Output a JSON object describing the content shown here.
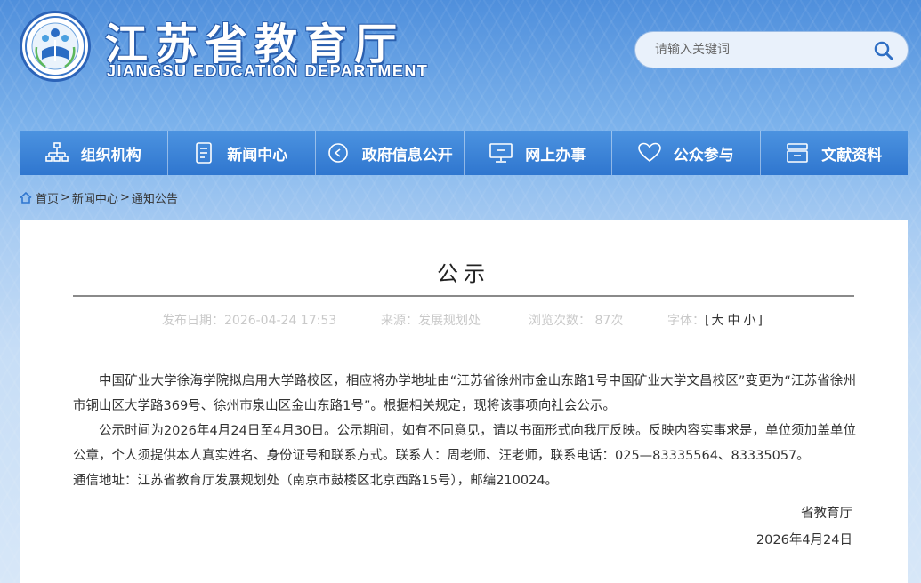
{
  "header": {
    "title": "江苏省教育厅",
    "subtitle": "JIANGSU EDUCATION DEPARTMENT",
    "search_placeholder": "请输入关键词"
  },
  "nav": {
    "items": [
      {
        "label": "组织机构",
        "icon": "org-chart-icon"
      },
      {
        "label": "新闻中心",
        "icon": "news-document-icon"
      },
      {
        "label": "政府信息公开",
        "icon": "info-disclosure-icon"
      },
      {
        "label": "网上办事",
        "icon": "monitor-icon"
      },
      {
        "label": "公众参与",
        "icon": "heart-icon"
      },
      {
        "label": "文献资料",
        "icon": "archive-icon"
      }
    ]
  },
  "breadcrumb": {
    "home": "首页",
    "sep": ">",
    "level1": "新闻中心",
    "level2": "通知公告"
  },
  "article": {
    "title": "公示",
    "publish": "发布日期：2026-04-24 17:53",
    "source": "来源：发展规划处",
    "views": "浏览次数： 87次",
    "font_label": "字体：",
    "font_large": "大",
    "font_medium": "中",
    "font_small": "小",
    "paragraph1": "中国矿业大学徐海学院拟启用大学路校区，相应将办学地址由“江苏省徐州市金山东路1号中国矿业大学文昌校区”变更为“江苏省徐州市铜山区大学路369号、徐州市泉山区金山东路1号”。根据相关规定，现将该事项向社会公示。",
    "paragraph2": "公示时间为2026年4月24日至4月30日。公示期间，如有不同意见，请以书面形式向我厅反映。反映内容实事求是，单位须加盖单位公章，个人须提供本人真实姓名、身份证号和联系方式。联系人：周老师、汪老师，联系电话：025—83335564、83335057。",
    "paragraph3": "通信地址：江苏省教育厅发展规划处（南京市鼓楼区北京西路15号），邮编210024。",
    "signer": "省教育厅",
    "sign_date": "2026年4月24日"
  },
  "colors": {
    "nav_blue": "#2f76cf",
    "meta_gray": "#c9c9c9",
    "logo_blue": "#2b63b8"
  }
}
